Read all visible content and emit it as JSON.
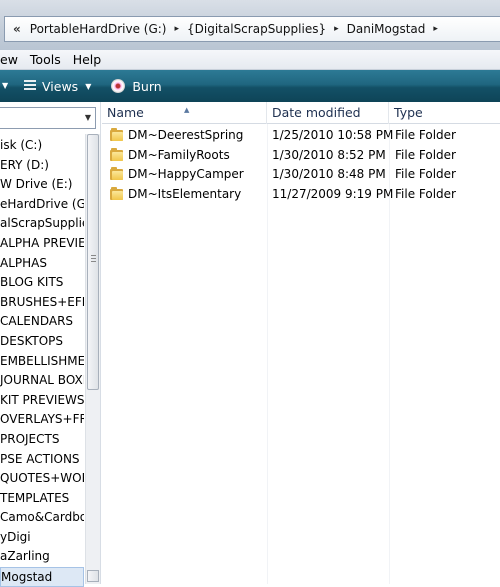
{
  "address": {
    "prefix": "«",
    "crumbs": [
      "PortableHardDrive (G:)",
      "{DigitalScrapSupplies}",
      "DaniMogstad"
    ]
  },
  "menu": [
    "ew",
    "Tools",
    "Help"
  ],
  "toolbar": {
    "views_label": "Views",
    "burn_label": "Burn"
  },
  "nav": {
    "items": [
      "isk (C:)",
      "ERY (D:)",
      "W Drive (E:)",
      "eHardDrive (G:)",
      "alScrapSupplies",
      "ALPHA PREVIEW",
      "ALPHAS",
      "BLOG KITS",
      "BRUSHES+EFFE",
      "CALENDARS",
      "DESKTOPS",
      "EMBELLISHMEN",
      "JOURNAL BOXE",
      "KIT PREVIEWS",
      "OVERLAYS+FRA",
      "PROJECTS",
      "PSE ACTIONS",
      "QUOTES+WOR",
      "TEMPLATES",
      "Camo&Cardbo",
      "yDigi",
      "aZarling",
      "Mogstad"
    ],
    "selected_index": 22
  },
  "columns": {
    "name": "Name",
    "date": "Date modified",
    "type": "Type"
  },
  "files": [
    {
      "name": "DM~DeerestSpring",
      "date": "1/25/2010 10:58 PM",
      "type": "File Folder"
    },
    {
      "name": "DM~FamilyRoots",
      "date": "1/30/2010 8:52 PM",
      "type": "File Folder"
    },
    {
      "name": "DM~HappyCamper",
      "date": "1/30/2010 8:48 PM",
      "type": "File Folder"
    },
    {
      "name": "DM~ItsElementary",
      "date": "11/27/2009 9:19 PM",
      "type": "File Folder"
    }
  ],
  "colors": {
    "command_bar": "#1f6680",
    "folder": "#f1c64a"
  }
}
